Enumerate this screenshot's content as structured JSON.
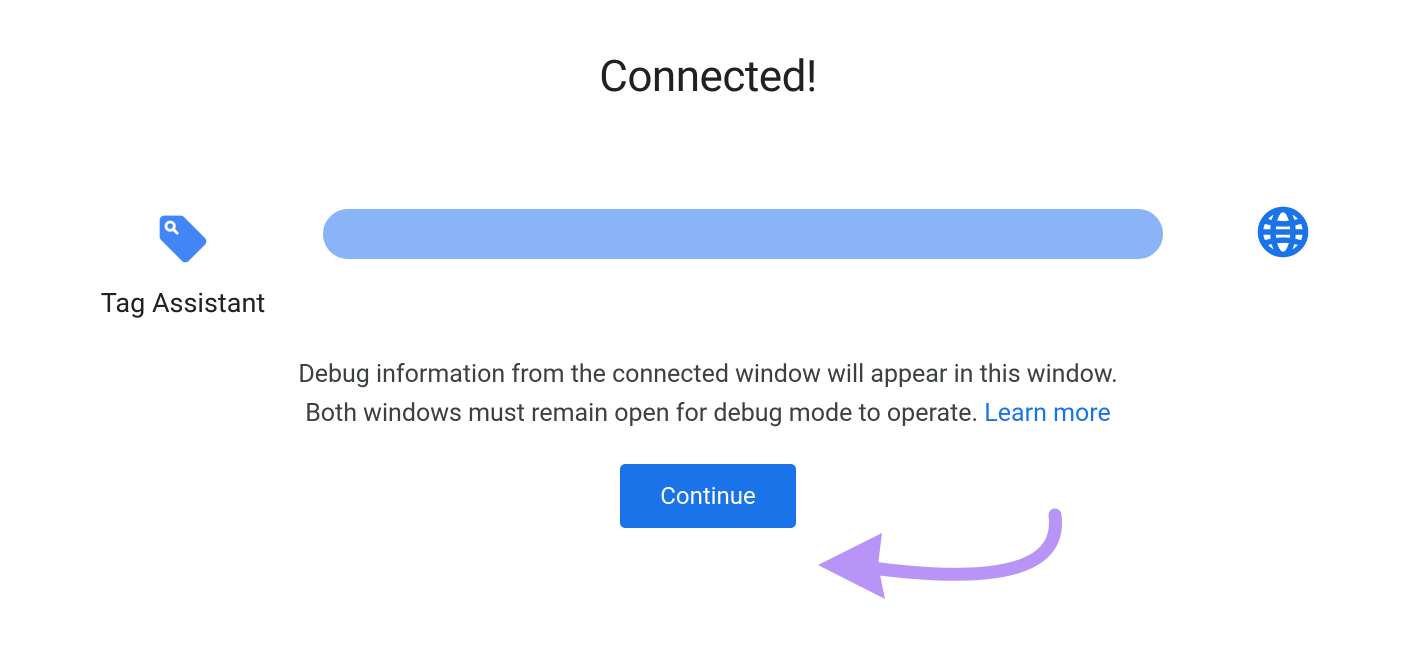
{
  "title": "Connected!",
  "left": {
    "label": "Tag Assistant",
    "icon": "tag-assistant-icon"
  },
  "right": {
    "icon": "globe-icon"
  },
  "info": {
    "line1": "Debug information from the connected window will appear in this window.",
    "line2_prefix": "Both windows must remain open for debug mode to operate. ",
    "learn_more": "Learn more"
  },
  "button": {
    "continue_label": "Continue"
  },
  "colors": {
    "accent": "#1a73e8",
    "progress": "#8ab4f8",
    "annotation": "#b794f6"
  }
}
